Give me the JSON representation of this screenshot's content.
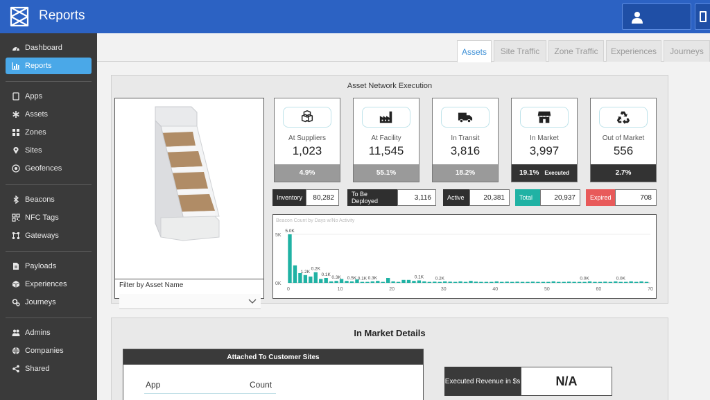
{
  "header": {
    "title": "Reports"
  },
  "sidebar": {
    "items": [
      {
        "label": "Dashboard",
        "icon": "dashboard-icon"
      },
      {
        "label": "Reports",
        "icon": "chart-icon",
        "active": true
      },
      {
        "label": "Apps",
        "icon": "tablet-icon"
      },
      {
        "label": "Assets",
        "icon": "asterisk-icon"
      },
      {
        "label": "Zones",
        "icon": "grid-icon"
      },
      {
        "label": "Sites",
        "icon": "map-pin-icon"
      },
      {
        "label": "Geofences",
        "icon": "target-icon"
      },
      {
        "label": "Beacons",
        "icon": "bluetooth-icon"
      },
      {
        "label": "NFC Tags",
        "icon": "qr-icon"
      },
      {
        "label": "Gateways",
        "icon": "network-icon"
      },
      {
        "label": "Payloads",
        "icon": "file-icon"
      },
      {
        "label": "Experiences",
        "icon": "cube-icon"
      },
      {
        "label": "Journeys",
        "icon": "cogs-icon"
      },
      {
        "label": "Admins",
        "icon": "users-icon"
      },
      {
        "label": "Companies",
        "icon": "building-icon"
      },
      {
        "label": "Shared",
        "icon": "share-icon"
      }
    ]
  },
  "tabs": [
    "Assets",
    "Site Traffic",
    "Zone Traffic",
    "Experiences",
    "Journeys"
  ],
  "execution": {
    "title": "Asset Network Execution",
    "filter_label": "Filter by Asset Name",
    "kpis": [
      {
        "label": "At Suppliers",
        "value": "1,023",
        "pct": "4.9%",
        "sub": "",
        "icon": "boxes-icon"
      },
      {
        "label": "At Facility",
        "value": "11,545",
        "pct": "55.1%",
        "sub": "",
        "icon": "factory-icon"
      },
      {
        "label": "In Transit",
        "value": "3,816",
        "pct": "18.2%",
        "sub": "",
        "icon": "truck-icon"
      },
      {
        "label": "In Market",
        "value": "3,997",
        "pct": "19.1%",
        "sub": "Executed",
        "icon": "store-icon"
      },
      {
        "label": "Out of Market",
        "value": "556",
        "pct": "2.7%",
        "sub": "",
        "icon": "recycle-icon"
      }
    ],
    "statuses": [
      {
        "label": "Inventory",
        "value": "80,282",
        "color": "#2f2f2f"
      },
      {
        "label": "To Be Deployed",
        "value": "3,116",
        "color": "#2f2f2f"
      },
      {
        "label": "Active",
        "value": "20,381",
        "color": "#2f2f2f"
      },
      {
        "label": "Total",
        "value": "20,937",
        "color": "#20b2a4"
      },
      {
        "label": "Expired",
        "value": "708",
        "color": "#e85a5a"
      }
    ]
  },
  "chart_data": {
    "type": "bar",
    "title": "Beacon Count by Days w/No Activity",
    "bar_color": "#20b2a4",
    "xlim": [
      0,
      70
    ],
    "ylim": [
      0,
      5000
    ],
    "x_ticks": [
      0,
      10,
      20,
      30,
      40,
      50,
      60,
      70
    ],
    "y_ticks": [
      {
        "value": 0,
        "label": "0K"
      },
      {
        "value": 5000,
        "label": "5K"
      }
    ],
    "x": [
      0,
      1,
      2,
      3,
      4,
      5,
      6,
      7,
      8,
      9,
      10,
      11,
      12,
      13,
      14,
      15,
      16,
      17,
      18,
      19,
      20,
      21,
      22,
      23,
      24,
      25,
      26,
      27,
      28,
      29,
      30,
      31,
      32,
      33,
      34,
      35,
      36,
      37,
      38,
      39,
      40,
      41,
      42,
      43,
      44,
      45,
      46,
      47,
      48,
      49,
      50,
      51,
      52,
      53,
      54,
      55,
      56,
      57,
      58,
      59,
      60,
      61,
      62,
      63,
      64,
      65,
      66,
      67,
      68,
      69
    ],
    "values": [
      5000,
      1800,
      1000,
      800,
      650,
      1100,
      400,
      500,
      150,
      200,
      400,
      200,
      150,
      350,
      100,
      100,
      150,
      200,
      100,
      500,
      150,
      100,
      300,
      300,
      200,
      250,
      150,
      100,
      120,
      100,
      150,
      120,
      100,
      150,
      100,
      200,
      120,
      100,
      100,
      100,
      150,
      100,
      120,
      100,
      120,
      100,
      100,
      120,
      100,
      100,
      100,
      150,
      100,
      100,
      120,
      100,
      100,
      100,
      150,
      100,
      100,
      120,
      100,
      150,
      100,
      100,
      150,
      100,
      150,
      100
    ],
    "data_labels": [
      {
        "x": 0,
        "label": "5.0K"
      },
      {
        "x": 3,
        "label": "1.2K"
      },
      {
        "x": 5,
        "label": "0.2K"
      },
      {
        "x": 7,
        "label": "0.1K"
      },
      {
        "x": 9,
        "label": "0.3K"
      },
      {
        "x": 12,
        "label": "0.5K"
      },
      {
        "x": 14,
        "label": "0.1K"
      },
      {
        "x": 16,
        "label": "0.3K"
      },
      {
        "x": 25,
        "label": "0.1K"
      },
      {
        "x": 29,
        "label": "0.2K"
      },
      {
        "x": 57,
        "label": "0.0K"
      },
      {
        "x": 64,
        "label": "0.0K"
      }
    ]
  },
  "details": {
    "title": "In Market Details",
    "attached_title": "Attached To Customer Sites",
    "col_app": "App",
    "col_count": "Count",
    "revenue_label": "Executed Revenue in $s",
    "revenue_value": "N/A"
  }
}
